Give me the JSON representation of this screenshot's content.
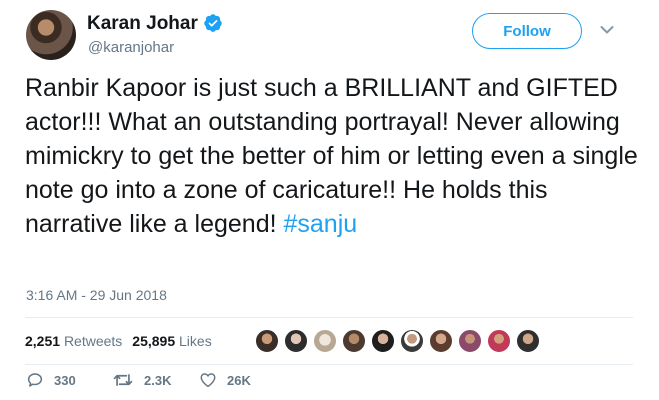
{
  "user": {
    "name": "Karan Johar",
    "handle": "@karanjohar"
  },
  "follow_button": {
    "label": "Follow"
  },
  "tweet": {
    "text": "Ranbir Kapoor is just such a BRILLIANT and GIFTED actor!!! What an outstanding portrayal! Never allowing mimickry to get the better of him or letting even a single note go into a zone of caricature!! He holds this narrative like a legend!",
    "hashtag": "#sanju",
    "timestamp": "3:16 AM - 29 Jun 2018"
  },
  "stats": {
    "retweets_count": "2,251",
    "retweets_label": "Retweets",
    "likes_count": "25,895",
    "likes_label": "Likes"
  },
  "actions": {
    "reply_count": "330",
    "retweet_count": "2.3K",
    "like_count": "26K"
  },
  "colors": {
    "accent": "#1da1f2",
    "muted_text": "#657786",
    "primary_text": "#14171a",
    "divider": "#e6ecf0"
  },
  "icons": [
    "verified-badge-icon",
    "chevron-down-icon",
    "reply-icon",
    "retweet-icon",
    "heart-icon"
  ]
}
